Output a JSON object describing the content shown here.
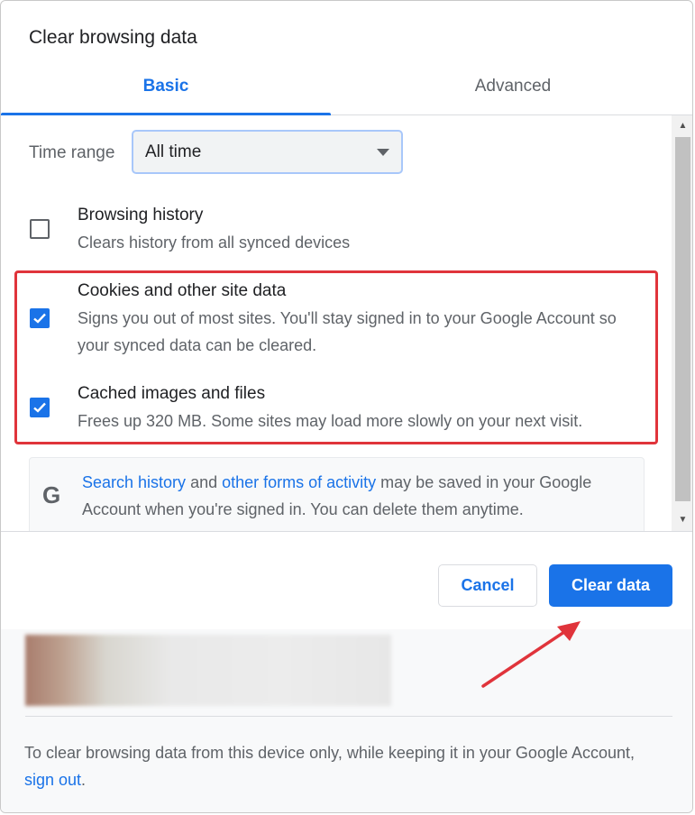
{
  "dialog": {
    "title": "Clear browsing data"
  },
  "tabs": [
    {
      "label": "Basic",
      "active": true
    },
    {
      "label": "Advanced",
      "active": false
    }
  ],
  "time_range": {
    "label": "Time range",
    "value": "All time"
  },
  "items": [
    {
      "title": "Browsing history",
      "description": "Clears history from all synced devices",
      "checked": false
    },
    {
      "title": "Cookies and other site data",
      "description": "Signs you out of most sites. You'll stay signed in to your Google Account so your synced data can be cleared.",
      "checked": true
    },
    {
      "title": "Cached images and files",
      "description": "Frees up 320 MB. Some sites may load more slowly on your next visit.",
      "checked": true
    }
  ],
  "google_notice": {
    "icon": "G",
    "link1": "Search history",
    "text1": " and ",
    "link2": "other forms of activity",
    "text2": " may be saved in your Google Account when you're signed in. You can delete them anytime."
  },
  "buttons": {
    "cancel": "Cancel",
    "clear": "Clear data"
  },
  "footer": {
    "text": "To clear browsing data from this device only, while keeping it in your Google Account, ",
    "link": "sign out",
    "tail": "."
  },
  "colors": {
    "accent": "#1a73e8",
    "highlight": "#e0343b"
  }
}
